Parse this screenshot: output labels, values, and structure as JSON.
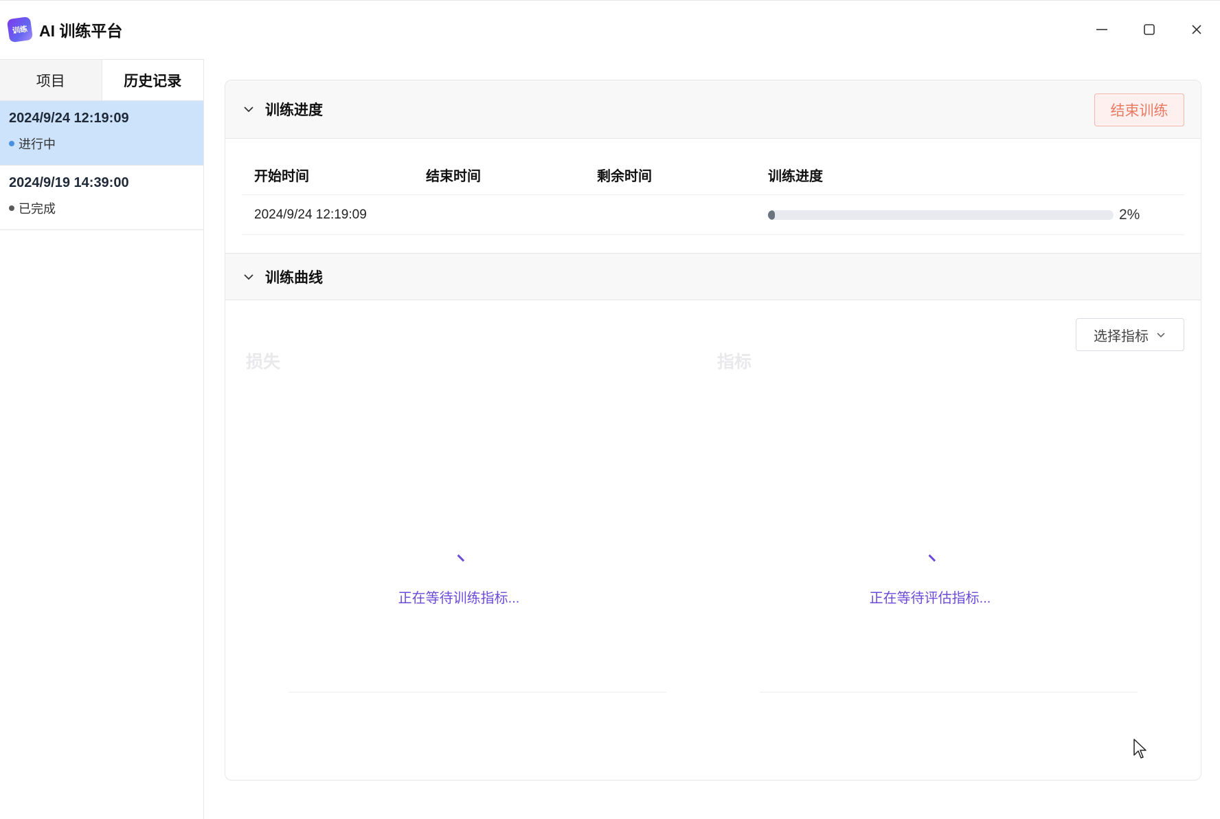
{
  "app": {
    "logo_text": "训练",
    "title": "AI 训练平台"
  },
  "window_controls": {
    "minimize": "minimize-icon",
    "maximize": "maximize-icon",
    "close": "close-icon"
  },
  "sidebar": {
    "tabs": [
      {
        "label": "项目",
        "active": false
      },
      {
        "label": "历史记录",
        "active": true
      }
    ],
    "history": [
      {
        "date": "2024/9/24 12:19:09",
        "status": "进行中",
        "status_color": "#4a90e2",
        "selected": true
      },
      {
        "date": "2024/9/19 14:39:00",
        "status": "已完成",
        "status_color": "#5a5a5a",
        "selected": false
      }
    ]
  },
  "progress_section": {
    "title": "训练进度",
    "end_button": "结束训练",
    "columns": [
      "开始时间",
      "结束时间",
      "剩余时间",
      "训练进度"
    ],
    "row": {
      "start": "2024/9/24 12:19:09",
      "end": "",
      "remaining": "",
      "progress_text": "2%",
      "progress_value": 0.02
    }
  },
  "curve_section": {
    "title": "训练曲线",
    "select_label": "选择指标",
    "panels": [
      {
        "title": "损失",
        "waiting": "正在等待训练指标..."
      },
      {
        "title": "指标",
        "waiting": "正在等待评估指标..."
      }
    ]
  },
  "colors": {
    "accent": "#6d4bd9",
    "danger": "#ea7a63",
    "selected_bg": "#cce3fb"
  }
}
